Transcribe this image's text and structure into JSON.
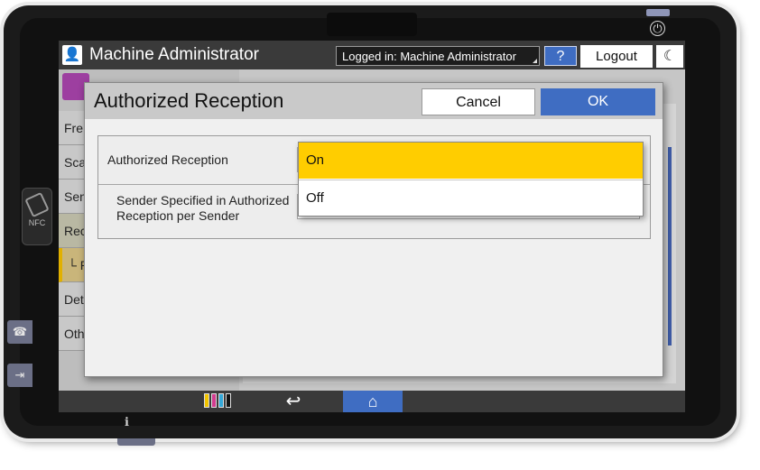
{
  "header": {
    "title": "Machine Administrator",
    "login_status": "Logged in: Machine Administrator",
    "help_label": "?",
    "logout_label": "Logout"
  },
  "left_menu": {
    "items": [
      "Fre",
      "Sca",
      "Sen",
      "Rec",
      "└ R",
      "Det",
      "Oth"
    ]
  },
  "device": {
    "nfc_label": "NFC"
  },
  "dialog": {
    "title": "Authorized Reception",
    "cancel_label": "Cancel",
    "ok_label": "OK",
    "rows": [
      {
        "label": "Authorized Reception"
      },
      {
        "label": "Sender Specified in Authorized\nReception per Sender"
      }
    ],
    "dropdown": {
      "options": [
        "On",
        "Off"
      ],
      "selected": "On"
    }
  },
  "colors": {
    "accent_blue": "#3f6dc2",
    "selected_yellow": "#ffcd00",
    "header_dark": "#3a3a3a"
  },
  "icons": {
    "user": "user-icon",
    "power": "power-icon",
    "night": "moon-icon",
    "back": "back-arrow-icon",
    "home": "home-icon",
    "toner": "toner-icon",
    "nfc": "nfc-icon"
  }
}
